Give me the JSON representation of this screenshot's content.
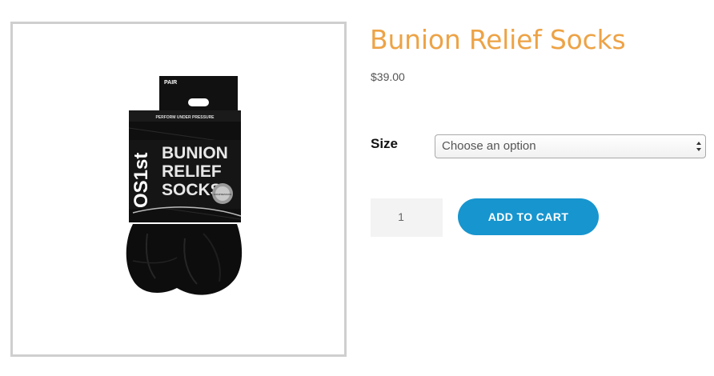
{
  "product": {
    "title": "Bunion Relief Socks",
    "price": "$39.00",
    "image": {
      "description": "product-photo",
      "package": {
        "tag": "PAIR",
        "tagline": "PERFORM UNDER PRESSURE",
        "brand": "OS1st",
        "name_lines": [
          "BUNION",
          "RELIEF",
          "SOCKS"
        ],
        "badge_text": "COMPRESSION"
      }
    }
  },
  "variation": {
    "size_label": "Size",
    "size_select_value": "Choose an option"
  },
  "cart": {
    "quantity": "1",
    "add_to_cart_label": "ADD TO CART"
  },
  "colors": {
    "title": "#eda346",
    "button": "#1795cf",
    "frame_border": "#cfcfcf",
    "qty_background": "#f3f3f3"
  }
}
